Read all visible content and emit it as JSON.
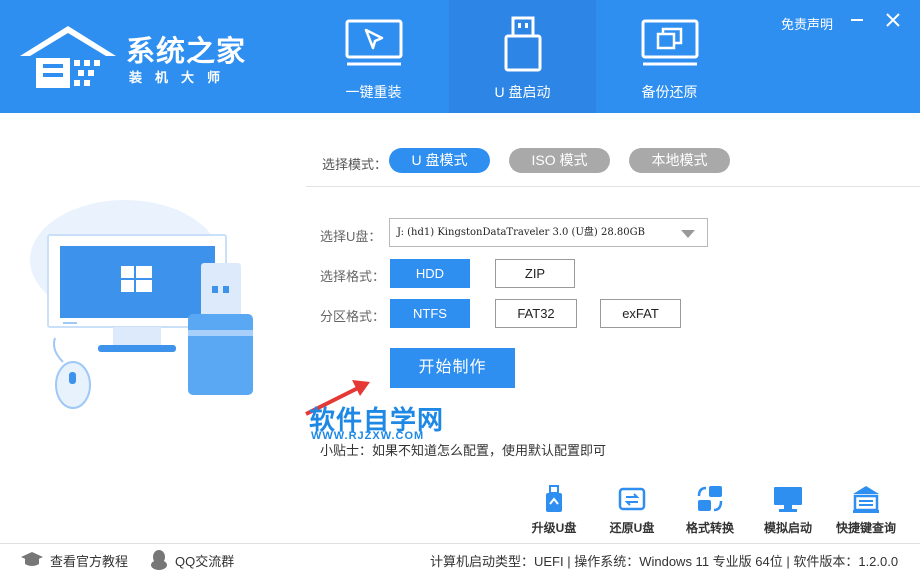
{
  "app": {
    "title": "系统之家",
    "subtitle": "装机大师"
  },
  "header": {
    "tabs": [
      {
        "label": "一键重装",
        "icon": "cursor-monitor-icon"
      },
      {
        "label": "U 盘启动",
        "icon": "usb-drive-icon",
        "active": true
      },
      {
        "label": "备份还原",
        "icon": "backup-restore-icon"
      }
    ],
    "disclaimer": "免责声明"
  },
  "mode": {
    "label": "选择模式：",
    "options": [
      "U 盘模式",
      "ISO 模式",
      "本地模式"
    ],
    "selected": "U 盘模式"
  },
  "form": {
    "usb_label": "选择U盘：",
    "usb_value": "J: (hd1) KingstonDataTraveler 3.0 (U盘) 28.80GB",
    "format_label": "选择格式：",
    "format_options": [
      "HDD",
      "ZIP"
    ],
    "format_selected": "HDD",
    "partition_label": "分区格式：",
    "partition_options": [
      "NTFS",
      "FAT32",
      "exFAT"
    ],
    "partition_selected": "NTFS",
    "start_button": "开始制作"
  },
  "watermark": {
    "text": "软件自学网",
    "url": "WWW.RJZXW.COM"
  },
  "tip": "小贴士：如果不知道怎么配置，使用默认配置即可",
  "toolbar": [
    {
      "label": "升级U盘",
      "icon": "upgrade-usb-icon"
    },
    {
      "label": "还原U盘",
      "icon": "restore-usb-icon"
    },
    {
      "label": "格式转换",
      "icon": "format-convert-icon"
    },
    {
      "label": "模拟启动",
      "icon": "simulate-boot-icon"
    },
    {
      "label": "快捷键查询",
      "icon": "hotkey-query-icon"
    }
  ],
  "footer": {
    "tutorial": "查看官方教程",
    "qq": "QQ交流群",
    "status": "计算机启动类型：UEFI | 操作系统：Windows 11 专业版 64位 | 软件版本：1.2.0.0"
  },
  "colors": {
    "accent": "#2f8ff0",
    "inactive_pill": "#a9a9a9"
  }
}
